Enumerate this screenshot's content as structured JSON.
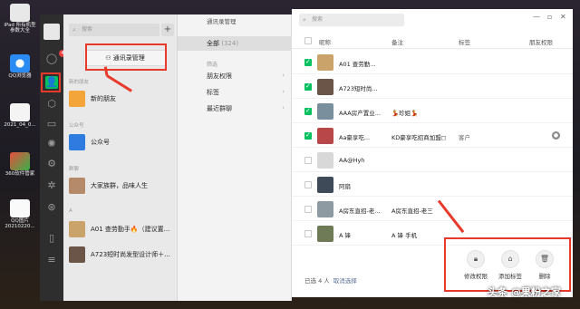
{
  "desktop_icons": [
    {
      "label": "iPad 所有机型参数大全"
    },
    {
      "label": "QQ浏览器"
    },
    {
      "label": "2021_04_0..."
    },
    {
      "label": "360软件管家"
    },
    {
      "label": "QQ图片20210220..."
    }
  ],
  "wechat_nav": {
    "unread_badge": "4"
  },
  "contacts_panel": {
    "search_placeholder": "搜索",
    "add_button": "+",
    "contacts_manager_button": "通讯录管理",
    "section_new_friends": "新的朋友",
    "new_friends_item": "新的朋友",
    "section_official": "公众号",
    "official_item": "公众号",
    "section_groups": "群聊",
    "group_item": "大家族群，品味人生",
    "section_a": "A",
    "contacts": [
      {
        "name": "A01 查劳勤手🔥（建议置..."
      },
      {
        "name": "A723短时尚发型设计师＋..."
      }
    ]
  },
  "filter_panel": {
    "title": "通讯录管理",
    "all_label": "全部",
    "all_count": "(324)",
    "filter_group": "筛选",
    "filters": [
      "朋友权限",
      "标签",
      "最近群聊"
    ]
  },
  "table": {
    "search_placeholder": "搜索",
    "headers": {
      "name": "昵称",
      "remark": "备注",
      "tag": "标签",
      "permission": "朋友权限"
    },
    "rows": [
      {
        "name": "A01 查劳勤...",
        "remark": "",
        "tag": "",
        "checked": true,
        "permission_icon": false,
        "color": "#c9a36a"
      },
      {
        "name": "A723短时尚...",
        "remark": "",
        "tag": "",
        "checked": true,
        "permission_icon": false,
        "color": "#6b5548"
      },
      {
        "name": "AAA房产置业...",
        "remark": "💃珍姐💃",
        "tag": "",
        "checked": true,
        "permission_icon": false,
        "color": "#7a8f9e"
      },
      {
        "name": "Aa豪享吃...",
        "remark": "KD豪享吃招商加盟◻",
        "tag": "客户",
        "checked": true,
        "permission_icon": true,
        "color": "#b8474a"
      },
      {
        "name": "AA@Hyh",
        "remark": "",
        "tag": "",
        "checked": false,
        "permission_icon": false,
        "color": "#d8d8d8"
      },
      {
        "name": "阿扇",
        "remark": "",
        "tag": "",
        "checked": false,
        "permission_icon": false,
        "color": "#3e4a57"
      },
      {
        "name": "A房东直招-老...",
        "remark": "A房东直招-老三",
        "tag": "",
        "checked": false,
        "permission_icon": false,
        "color": "#8d9aa2"
      },
      {
        "name": "A 锋",
        "remark": "A 锋 手机",
        "tag": "",
        "checked": false,
        "permission_icon": false,
        "color": "#6f7a56"
      }
    ],
    "selection_text": "已选 4 人",
    "cancel_selection": "取消选择",
    "actions": [
      {
        "label": "修改权限",
        "icon": "lock-icon"
      },
      {
        "label": "添加标签",
        "icon": "tag-icon"
      },
      {
        "label": "删除",
        "icon": "trash-icon"
      }
    ]
  },
  "watermark": "头条 @果粉之家",
  "colors": {
    "accent_green": "#07c160",
    "highlight_red": "#e83a2a",
    "link_blue": "#576b95"
  }
}
